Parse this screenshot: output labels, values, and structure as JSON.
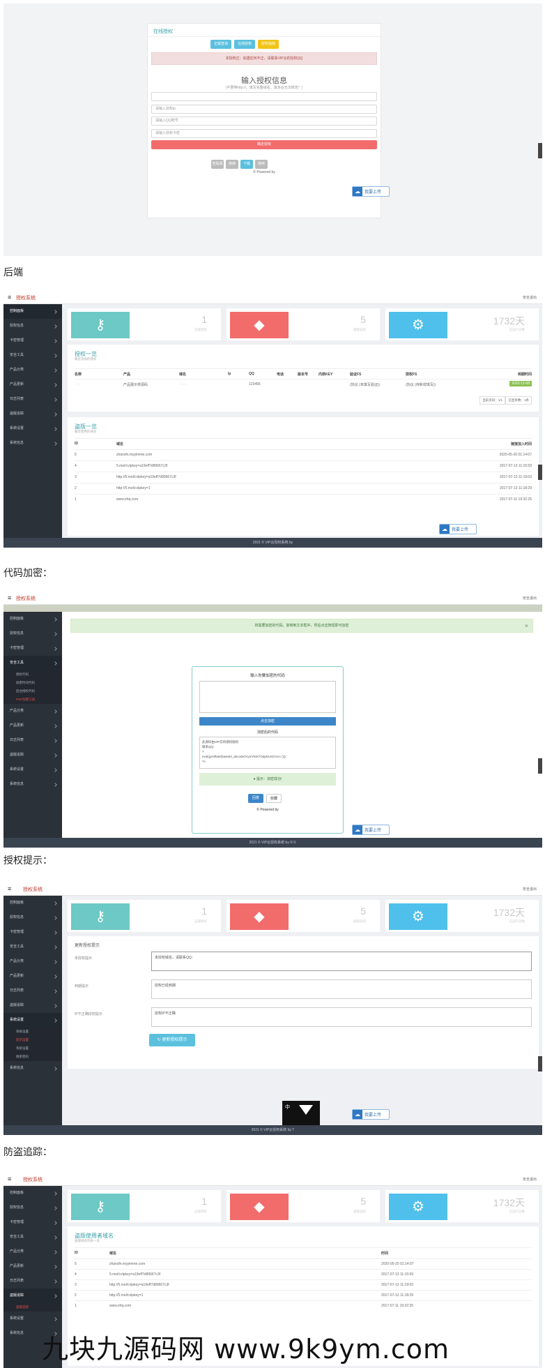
{
  "shot1": {
    "panel_title": "在线授权",
    "btn_query": "正版查询",
    "btn_auth": "在线授权",
    "btn_guide": "授权指南",
    "notice": "本授权正：如遇任何不正，请联系VIP云的授权QQ",
    "heading": "输入授权信息",
    "sub_heading": "(不要带http://，填写完整域名，填多后无法修改！)",
    "input1": "",
    "input2": "请输入授权ip",
    "input3": "请输入QQ账号",
    "input4": "请输入授权卡密",
    "submit": "确定授权",
    "footer_btns": [
      "查看源码",
      "换绑",
      "下载",
      "使用"
    ],
    "powered": "© Powered by",
    "upload": "我要上传"
  },
  "cap1": "后端",
  "admin": {
    "brand": "授权系统",
    "user_menu": "安全退出",
    "stats": [
      {
        "num": "1",
        "label": "正版授权"
      },
      {
        "num": "5",
        "label": "盗版追踪"
      },
      {
        "num": "1732天",
        "label": "已运行天数"
      }
    ],
    "footer": "2021 © VIP云授权系统 by"
  },
  "menu": [
    "控制面板",
    "授权信息",
    "卡密管理",
    "安全工具",
    "产品分类",
    "产品更新",
    "日志列表",
    "盗版追踪",
    "系统设置",
    "系统信息"
  ],
  "shot2": {
    "panel1_title": "授权一览",
    "panel1_sub": "最近添加的授权",
    "cols": [
      "名称",
      "产品",
      "域名",
      "Ip",
      "QQ",
      "电话",
      "版本号",
      "内核KEY",
      "验证FS",
      "",
      "授权FS",
      "",
      "到期时间"
    ],
    "row": [
      "·  ·  ·",
      "产品展示类源码",
      "· ·   · ·",
      "",
      "123456",
      "",
      "",
      "",
      "(协议 (未填写验证))",
      "",
      "(协议 (待新增填写))",
      "",
      "2022-12-08"
    ],
    "pager": [
      "当前页码：1/1",
      "已显条数：1条"
    ],
    "panel2_title": "盗版一览",
    "panel2_sub": "最近使用的域名",
    "cols2": [
      "ID",
      "域名",
      "链接加入时间"
    ],
    "rows2": [
      [
        "5",
        "zhansfn.myyimme.com",
        "2020-05-20 01:14:07"
      ],
      [
        "4",
        "5.mel/cvlpkey=a19eff7d89667c3f",
        "2017-07-13 11:15:59"
      ],
      [
        "3",
        "http://5.mel/cvlpkey=a19eff7d89667c3f",
        "2017-07-13 11:19:03"
      ],
      [
        "2",
        "http://5.mel/cvlpkey=1",
        "2017-07-13 11:18:29"
      ],
      [
        "1",
        "www.ehq.com",
        "2017-07-11 19:32:25"
      ]
    ]
  },
  "cap2": "代码加密：",
  "shot3": {
    "banner": "将需要加密的代码，复制到文本框中，然后点击按钮即可加密",
    "panel_title": "输入你要加密的代码",
    "encrypt_btn": "点击加密",
    "result_title": "加密后的代码",
    "result_text": "此源码由VIP云的授权版权\n联系QQ：\n?\neval(gzinflate(base64_decode('KyIzYktKTOdpDUtOAoA=')));\n?>",
    "success": "提示：加密成功!",
    "btns": [
      "回复",
      "收藏"
    ],
    "powered": "© Powered by",
    "sub_menu": [
      "授权代码",
      "加密时间代码",
      "后台授权代码",
      "PHP加密工具"
    ],
    "footer": "2021 © VIP云授权系统 by © 0."
  },
  "cap3": "授权提示：",
  "shot4": {
    "section": "更新授权提示",
    "labels": [
      "未授权提示",
      "到期提示",
      "IP不正确授权提示"
    ],
    "values": [
      "未授权域名，请联系QQ：",
      "授权已经到期",
      "授权IP不正确"
    ],
    "btn": "更新授权提示",
    "sub_menu": [
      "系统设置",
      "提示设置",
      "系统设置",
      "搜索密码"
    ],
    "footer": "2021 © VIP云授权系统 by T",
    "overlay": "中"
  },
  "cap4": "防盗追踪：",
  "shot5": {
    "panel_title": "盗版使用者域名",
    "panel_sub": "盗版域名列表一览",
    "cols": [
      "ID",
      "域名",
      "时间"
    ],
    "rows": [
      [
        "5",
        "zhansfn.myyimme.com",
        "2020-05-20 01:14:07"
      ],
      [
        "4",
        "5.mel/cvlpkey=a19eff7d89667c3f",
        "2017-07-13 11:15:59"
      ],
      [
        "3",
        "http://5.mel/cvlpkey=a19eff7d89667c3f",
        "2017-07-13 11:19:03"
      ],
      [
        "2",
        "http://5.mel/cvlpkey=1",
        "2017-07-13 11:18:29"
      ],
      [
        "1",
        "www.ehq.com",
        "2017-07-11 19:32:25"
      ]
    ],
    "sub_menu": [
      "盗版追踪"
    ]
  },
  "watermark": "九块九源码网 www.9k9ym.com",
  "colors": {
    "teal": "#6cc9c5",
    "red": "#f26c6c",
    "blue": "#4fc0ec",
    "sidebar": "#2b3139",
    "accent": "#3aa0a8"
  }
}
